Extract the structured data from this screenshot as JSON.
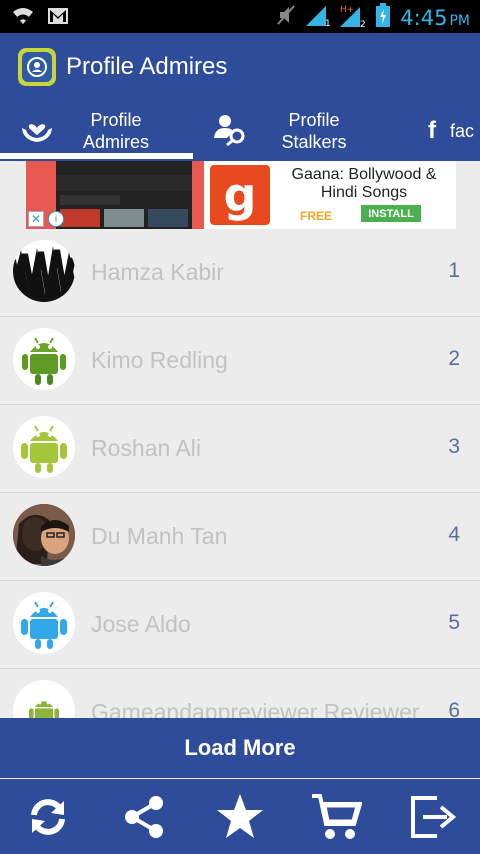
{
  "statusbar": {
    "time": "4:45",
    "ampm": "PM"
  },
  "app": {
    "title": "Profile Admires"
  },
  "tabs": [
    {
      "label": "Profile Admires",
      "line1": "Profile",
      "line2": "Admires"
    },
    {
      "label": "Profile Stalkers",
      "line1": "Profile",
      "line2": "Stalkers"
    },
    {
      "label": "fac"
    }
  ],
  "ad": {
    "title": "Gaana: Bollywood & Hindi Songs",
    "price": "FREE",
    "install_label": "INSTALL",
    "logo_letter": "g",
    "close_glyph": "✕",
    "info_glyph": "i"
  },
  "list": [
    {
      "name": "Hamza Kabir",
      "rank": "1",
      "avatar": "zigzag-avatar"
    },
    {
      "name": "Kimo Redling",
      "rank": "2",
      "avatar": "android-3d-avatar"
    },
    {
      "name": "Roshan Ali",
      "rank": "3",
      "avatar": "android-green-avatar"
    },
    {
      "name": "Du Manh Tan",
      "rank": "4",
      "avatar": "photo-avatar"
    },
    {
      "name": "Jose Aldo",
      "rank": "5",
      "avatar": "android-blue-avatar"
    },
    {
      "name": "Gameandappreviewer Reviewer",
      "rank": "6",
      "avatar": "android-green-avatar"
    }
  ],
  "load_more_label": "Load More",
  "bottom_icons": [
    "refresh-icon",
    "share-icon",
    "star-icon",
    "cart-icon",
    "logout-icon"
  ],
  "colors": {
    "primary": "#2e4c9a",
    "status_text": "#33b5e5",
    "name_text": "#c2c2c2",
    "rank_text": "#5a6e9c"
  }
}
